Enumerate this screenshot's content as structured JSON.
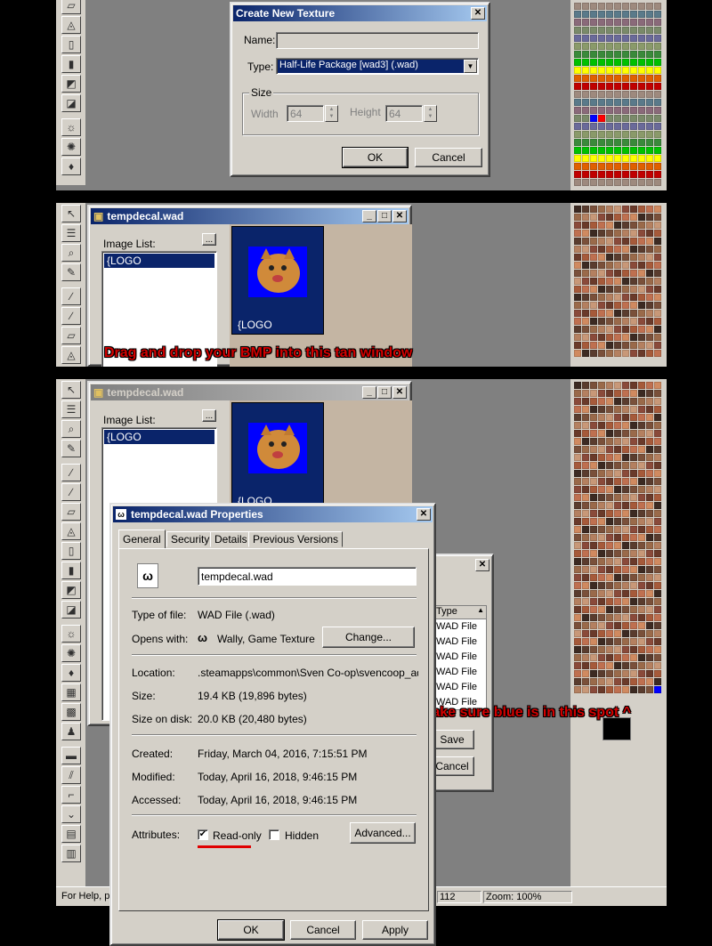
{
  "create_texture_dialog": {
    "title": "Create New Texture",
    "name_label": "Name:",
    "name_value": "",
    "type_label": "Type:",
    "type_value": "Half-Life Package [wad3] (.wad)",
    "size_group": "Size",
    "width_label": "Width",
    "width_value": "64",
    "height_label": "Height",
    "height_value": "64",
    "ok_label": "OK",
    "cancel_label": "Cancel"
  },
  "wad_window": {
    "title": "tempdecal.wad",
    "image_list_label": "Image List:",
    "more_label": "...",
    "items": [
      "{LOGO"
    ],
    "thumb_caption": "{LOGO"
  },
  "captions": {
    "drag_drop": "Drag and drop your BMP into this tan window",
    "make_sure_blue": "Make sure blue is in this spot ^"
  },
  "properties_dialog": {
    "title": "tempdecal.wad Properties",
    "tabs": [
      "General",
      "Security",
      "Details",
      "Previous Versions"
    ],
    "filename": "tempdecal.wad",
    "type_label": "Type of file:",
    "type_value": "WAD File (.wad)",
    "opens_label": "Opens with:",
    "opens_value": "Wally, Game Texture E",
    "change_label": "Change...",
    "location_label": "Location:",
    "location_value": ".steamapps\\common\\Sven Co-op\\svencoop_addon",
    "size_label": "Size:",
    "size_value": "19.4 KB (19,896 bytes)",
    "size_disk_label": "Size on disk:",
    "size_disk_value": "20.0 KB (20,480 bytes)",
    "created_label": "Created:",
    "created_value": "Friday, March 04, 2016, 7:15:51 PM",
    "modified_label": "Modified:",
    "modified_value": "Today, April 16, 2018, 9:46:15 PM",
    "accessed_label": "Accessed:",
    "accessed_value": "Today, April 16, 2018, 9:46:15 PM",
    "attributes_label": "Attributes:",
    "readonly_label": "Read-only",
    "readonly_checked": true,
    "hidden_label": "Hidden",
    "hidden_checked": false,
    "advanced_label": "Advanced...",
    "ok_label": "OK",
    "cancel_label": "Cancel",
    "apply_label": "Apply"
  },
  "background_save_dialog": {
    "column_header": "Type",
    "rows": [
      "WAD File",
      "WAD File",
      "WAD File",
      "WAD File",
      "WAD File",
      "WAD File",
      "WAD File"
    ],
    "save_label": "Save",
    "cancel_label": "Cancel"
  },
  "status_bar": {
    "help_text": "For Help, p",
    "coord": "112",
    "zoom": "Zoom: 100%"
  },
  "colors": {
    "title_active": "#0a246a",
    "face": "#d4d0c8",
    "workspace": "#808080",
    "tan_area": "#c4b5a3",
    "caption_red": "#d40000",
    "highlight_blue": "#0000ff"
  }
}
